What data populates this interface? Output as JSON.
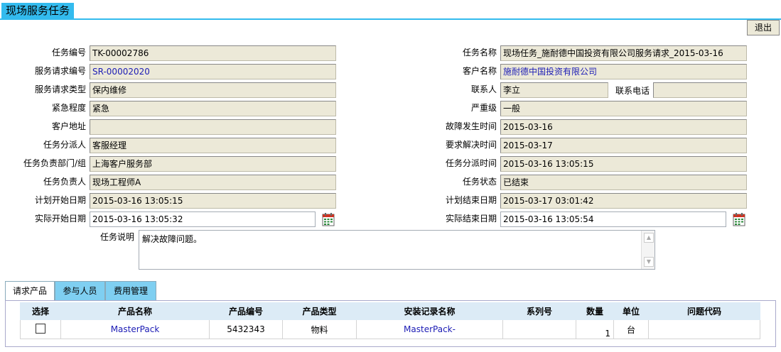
{
  "page_title": "现场服务任务",
  "exit_label": "退出",
  "left_fields": [
    {
      "label": "任务编号",
      "value": "TK-00002786"
    },
    {
      "label": "服务请求编号",
      "value": "SR-00002020"
    },
    {
      "label": "服务请求类型",
      "value": "保内维修"
    },
    {
      "label": "紧急程度",
      "value": "紧急"
    },
    {
      "label": "客户地址",
      "value": ""
    },
    {
      "label": "任务分派人",
      "value": "客服经理"
    },
    {
      "label": "任务负责部门/组",
      "value": "上海客户服务部"
    },
    {
      "label": "任务负责人",
      "value": "现场工程师A"
    },
    {
      "label": "计划开始日期",
      "value": "2015-03-16 13:05:15"
    },
    {
      "label": "实际开始日期",
      "value": "2015-03-16 13:05:32"
    }
  ],
  "right_fields": [
    {
      "label": "任务名称",
      "value": "现场任务_施耐德中国投资有限公司服务请求_2015-03-16"
    },
    {
      "label": "客户名称",
      "value": "施耐德中国投资有限公司"
    },
    {
      "label": "联系人",
      "value": "李立"
    },
    {
      "label": "严重级",
      "value": "一般"
    },
    {
      "label": "故障发生时间",
      "value": "2015-03-16"
    },
    {
      "label": "要求解决时间",
      "value": "2015-03-17"
    },
    {
      "label": "任务分派时间",
      "value": "2015-03-16 13:05:15"
    },
    {
      "label": "任务状态",
      "value": "已结束"
    },
    {
      "label": "计划结束日期",
      "value": "2015-03-17 03:01:42"
    },
    {
      "label": "实际结束日期",
      "value": "2015-03-16 13:05:54"
    }
  ],
  "contact_phone": {
    "label": "联系电话",
    "value": ""
  },
  "description": {
    "label": "任务说明",
    "value": "解决故障问题。"
  },
  "tabs": [
    {
      "label": "请求产品"
    },
    {
      "label": "参与人员"
    },
    {
      "label": "费用管理"
    }
  ],
  "table": {
    "headers": [
      "选择",
      "产品名称",
      "产品编号",
      "产品类型",
      "安装记录名称",
      "系列号",
      "数量",
      "单位",
      "问题代码"
    ],
    "rows": [
      {
        "product_name": "MasterPack",
        "product_code": "5432343",
        "product_type": "物料",
        "install_record": "MasterPack-",
        "serial": "",
        "quantity": "1",
        "unit": "台",
        "problem_code": ""
      }
    ]
  },
  "icons": {
    "calendar": "calendar-icon"
  },
  "colors": {
    "accent": "#33bbee",
    "tab_inactive": "#7fcff1",
    "header_bg": "#dcebf6",
    "link": "#1c1cb5"
  }
}
